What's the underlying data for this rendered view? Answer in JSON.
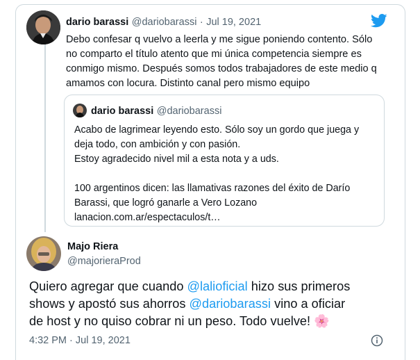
{
  "top_tweet": {
    "author_name": "dario barassi",
    "author_handle": "@dariobarassi",
    "separator": "·",
    "date": "Jul 19, 2021",
    "text_lines": [
      "Debo confesar q vuelvo a leerla y me sigue poniendo contento. Sólo",
      "no comparto el título atento que mi única competencia siempre es",
      "conmigo mismo. Después somos todos trabajadores de este medio q",
      "amamos con locura. Distinto canal pero mismo equipo"
    ],
    "brand_icon": "twitter-bird-icon",
    "brand_color": "#1d9bf0"
  },
  "quoted_tweet": {
    "author_name": "dario barassi",
    "author_handle": "@dariobarassi",
    "text_lines": [
      "Acabo de lagrimear leyendo esto. Sólo soy un gordo que juega y",
      "deja todo, con ambición y con pasión.",
      "Estoy agradecido nivel mil a esta nota y a uds.",
      "",
      "100 argentinos dicen: las llamativas razones del éxito de Darío",
      "Barassi, que logró ganarle a Vero Lozano",
      "lanacion.com.ar/espectaculos/t…"
    ]
  },
  "main_tweet": {
    "author_name": "Majo Riera",
    "author_handle": "@majorieraProd",
    "line1_a": "Quiero agregar que cuando ",
    "mention1": "@lalioficial",
    "line1_b": " hizo sus primeros",
    "line2_a": "shows y apostó sus ahorros ",
    "mention2": "@dariobarassi",
    "line2_b": " vino a oficiar",
    "line3": "de host y no quiso cobrar ni un peso. Todo vuelve! ",
    "emoji": "🌸",
    "time": "4:32 PM",
    "separator": "·",
    "date": "Jul 19, 2021",
    "info_icon": "info-icon"
  },
  "colors": {
    "text": "#0f1419",
    "secondary": "#536471",
    "border": "#cfd9de",
    "link": "#1d9bf0"
  }
}
